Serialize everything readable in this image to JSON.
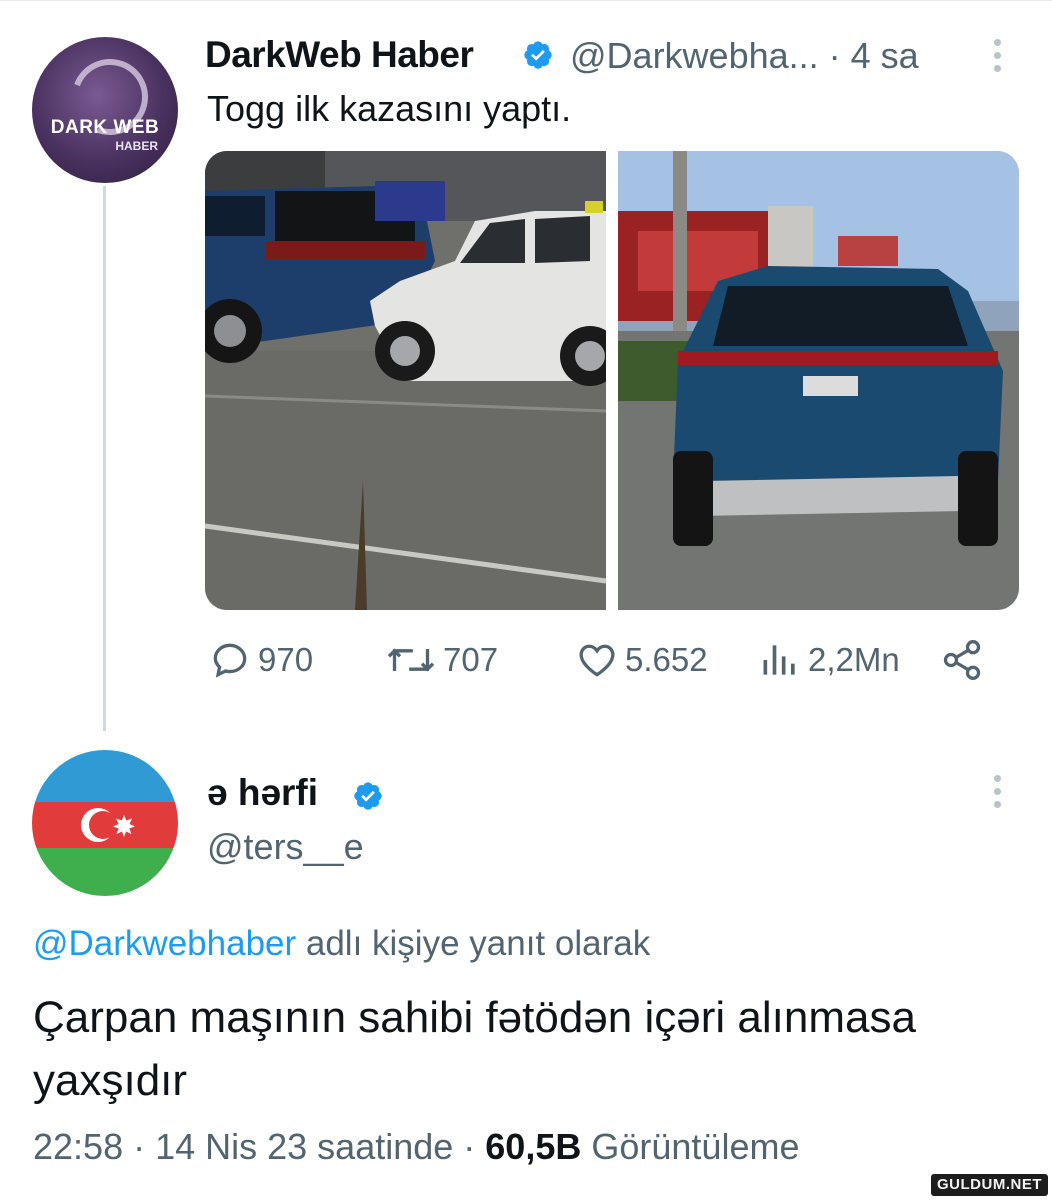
{
  "tweet1": {
    "author_name": "DarkWeb Haber",
    "handle": "@Darkwebha...",
    "time": "· 4 sa",
    "text": "Togg ilk kazasını yaptı.",
    "avatar_text": "DARK WEB",
    "avatar_subtext": "HABER",
    "stats": {
      "replies": "970",
      "retweets": "707",
      "likes": "5.652",
      "views": "2,2Mn"
    }
  },
  "tweet2": {
    "author_name": "ə hərfi",
    "handle": "@ters__e",
    "reply_mention": "@Darkwebhaber",
    "reply_suffix": " adlı kişiye yanıt olarak",
    "text": "Çarpan maşının sahibi fətödən içəri alınmasa yaxşıdır",
    "timestamp": "22:58 · 14 Nis 23 saatinde · ",
    "view_count": "60,5B",
    "view_label": " Görüntüleme"
  },
  "watermark": "GULDUM.NET",
  "colors": {
    "verified": "#1d9bf0",
    "secondary_text": "#536471",
    "link": "#1d9bf0"
  }
}
